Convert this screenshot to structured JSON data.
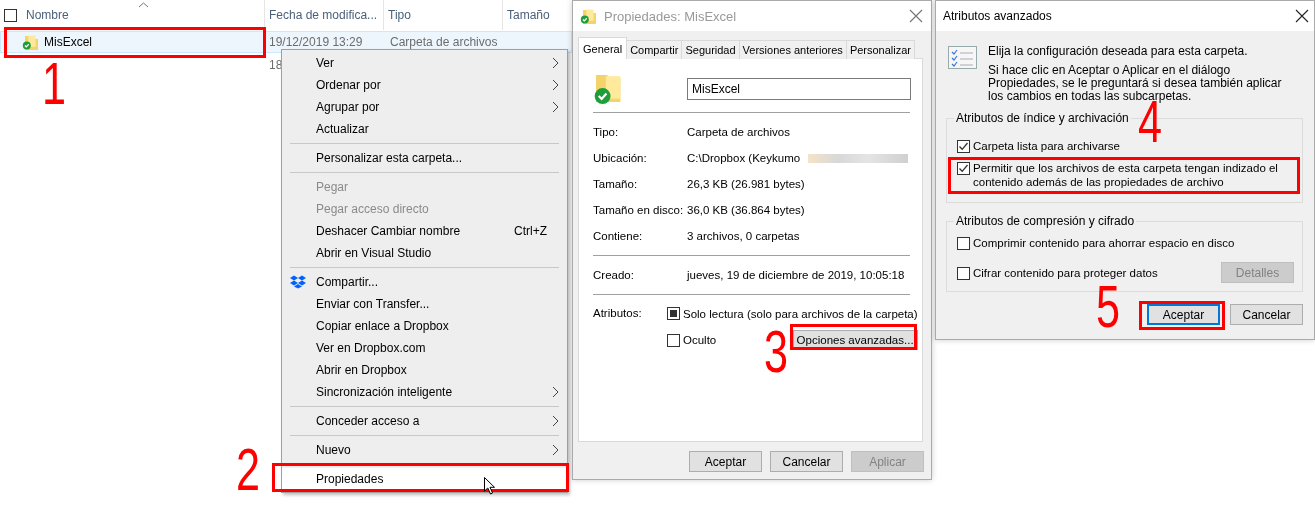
{
  "explorer": {
    "select_all": {
      "checked": false
    },
    "columns": [
      {
        "label": "Nombre",
        "sorted": true
      },
      {
        "label": "Fecha de modifica...",
        "sorted": false
      },
      {
        "label": "Tipo",
        "sorted": false
      },
      {
        "label": "Tamaño",
        "sorted": false
      }
    ],
    "rows": [
      {
        "name": "MisExcel",
        "date": "19/12/2019 13:29",
        "type": "Carpeta de archivos",
        "selected": true
      },
      {
        "date": "18",
        "selected": false
      }
    ]
  },
  "context_menu": {
    "items": [
      {
        "kind": "item",
        "label": "Ver",
        "submenu": true,
        "disabled": false,
        "selected": false
      },
      {
        "kind": "item",
        "label": "Ordenar por",
        "submenu": true,
        "disabled": false,
        "selected": false
      },
      {
        "kind": "item",
        "label": "Agrupar por",
        "submenu": true,
        "disabled": false,
        "selected": false
      },
      {
        "kind": "item",
        "label": "Actualizar",
        "submenu": false,
        "disabled": false,
        "selected": false
      },
      {
        "kind": "separator"
      },
      {
        "kind": "item",
        "label": "Personalizar esta carpeta...",
        "submenu": false,
        "disabled": false,
        "selected": false
      },
      {
        "kind": "separator"
      },
      {
        "kind": "item",
        "label": "Pegar",
        "submenu": false,
        "disabled": true,
        "selected": false
      },
      {
        "kind": "item",
        "label": "Pegar acceso directo",
        "submenu": false,
        "disabled": true,
        "selected": false
      },
      {
        "kind": "item",
        "label": "Deshacer Cambiar nombre",
        "shortcut": "Ctrl+Z",
        "submenu": false,
        "disabled": false,
        "selected": false
      },
      {
        "kind": "item",
        "label": "Abrir en Visual Studio",
        "submenu": false,
        "disabled": false,
        "selected": false
      },
      {
        "kind": "separator"
      },
      {
        "kind": "icon_item",
        "label": "Compartir...",
        "submenu": false,
        "disabled": false,
        "selected": false
      },
      {
        "kind": "item",
        "label": "Enviar con Transfer...",
        "submenu": false,
        "disabled": false,
        "selected": false
      },
      {
        "kind": "item",
        "label": "Copiar enlace a Dropbox",
        "submenu": false,
        "disabled": false,
        "selected": false
      },
      {
        "kind": "item",
        "label": "Ver en Dropbox.com",
        "submenu": false,
        "disabled": false,
        "selected": false
      },
      {
        "kind": "item",
        "label": "Abrir en Dropbox",
        "submenu": false,
        "disabled": false,
        "selected": false
      },
      {
        "kind": "item",
        "label": "Sincronización inteligente",
        "submenu": true,
        "disabled": false,
        "selected": false
      },
      {
        "kind": "separator"
      },
      {
        "kind": "item",
        "label": "Conceder acceso a",
        "submenu": true,
        "disabled": false,
        "selected": false
      },
      {
        "kind": "separator"
      },
      {
        "kind": "item",
        "label": "Nuevo",
        "submenu": true,
        "disabled": false,
        "selected": false
      },
      {
        "kind": "separator"
      },
      {
        "kind": "item",
        "label": "Propiedades",
        "submenu": false,
        "disabled": false,
        "selected": true
      }
    ]
  },
  "properties_dialog": {
    "title": "Propiedades: MisExcel",
    "tabs": [
      {
        "label": "General",
        "selected": true
      },
      {
        "label": "Compartir",
        "selected": false
      },
      {
        "label": "Seguridad",
        "selected": false
      },
      {
        "label": "Versiones anteriores",
        "selected": false
      },
      {
        "label": "Personalizar",
        "selected": false
      }
    ],
    "name_field": {
      "value": "MisExcel"
    },
    "info": [
      {
        "label": "Tipo:",
        "value": "Carpeta de archivos",
        "redacted": false
      },
      {
        "label": "Ubicación:",
        "value": "C:\\Dropbox (Keykumo",
        "redacted": true
      },
      {
        "label": "Tamaño:",
        "value": "26,3 KB (26.981 bytes)",
        "redacted": false
      },
      {
        "label": "Tamaño en disco:",
        "value": "36,0 KB (36.864 bytes)",
        "redacted": false
      },
      {
        "label": "Contiene:",
        "value": "3 archivos, 0 carpetas",
        "redacted": false
      }
    ],
    "created": {
      "label": "Creado:",
      "value": "jueves, 19 de diciembre de 2019, 10:05:18"
    },
    "attributes": {
      "label": "Atributos:",
      "options": [
        {
          "label": "Solo lectura (solo para archivos de la carpeta)",
          "checked": false,
          "indeterminate": true
        },
        {
          "label": "Oculto",
          "checked": false,
          "indeterminate": false
        }
      ],
      "advanced_button": "Opciones avanzadas..."
    },
    "buttons": [
      {
        "label": "Aceptar",
        "disabled": false
      },
      {
        "label": "Cancelar",
        "disabled": false
      },
      {
        "label": "Aplicar",
        "disabled": true
      }
    ]
  },
  "advanced_dialog": {
    "title": "Atributos avanzados",
    "intro": "Elija la configuración deseada para esta carpeta.",
    "note": "Si hace clic en Aceptar o Aplicar en el diálogo Propiedades, se le preguntará si desea también aplicar los cambios en todas las subcarpetas.",
    "groups": [
      {
        "title": "Atributos de índice y archivación",
        "options": [
          {
            "label": "Carpeta lista para archivarse",
            "checked": true,
            "highlighted": false
          },
          {
            "label": "Permitir que los archivos de esta carpeta tengan indizado el contenido además de las propiedades de archivo",
            "checked": true,
            "highlighted": true
          }
        ]
      },
      {
        "title": "Atributos de compresión y cifrado",
        "options": [
          {
            "label": "Comprimir contenido para ahorrar espacio en disco",
            "checked": false,
            "highlighted": false
          },
          {
            "label": "Cifrar contenido para proteger datos",
            "checked": false,
            "highlighted": false
          }
        ],
        "button": {
          "label": "Detalles",
          "disabled": true
        }
      }
    ],
    "buttons": [
      {
        "label": "Aceptar",
        "default": true
      },
      {
        "label": "Cancelar",
        "default": false
      }
    ]
  },
  "annotations": [
    {
      "number": "1"
    },
    {
      "number": "2"
    },
    {
      "number": "3"
    },
    {
      "number": "4"
    },
    {
      "number": "5"
    }
  ]
}
